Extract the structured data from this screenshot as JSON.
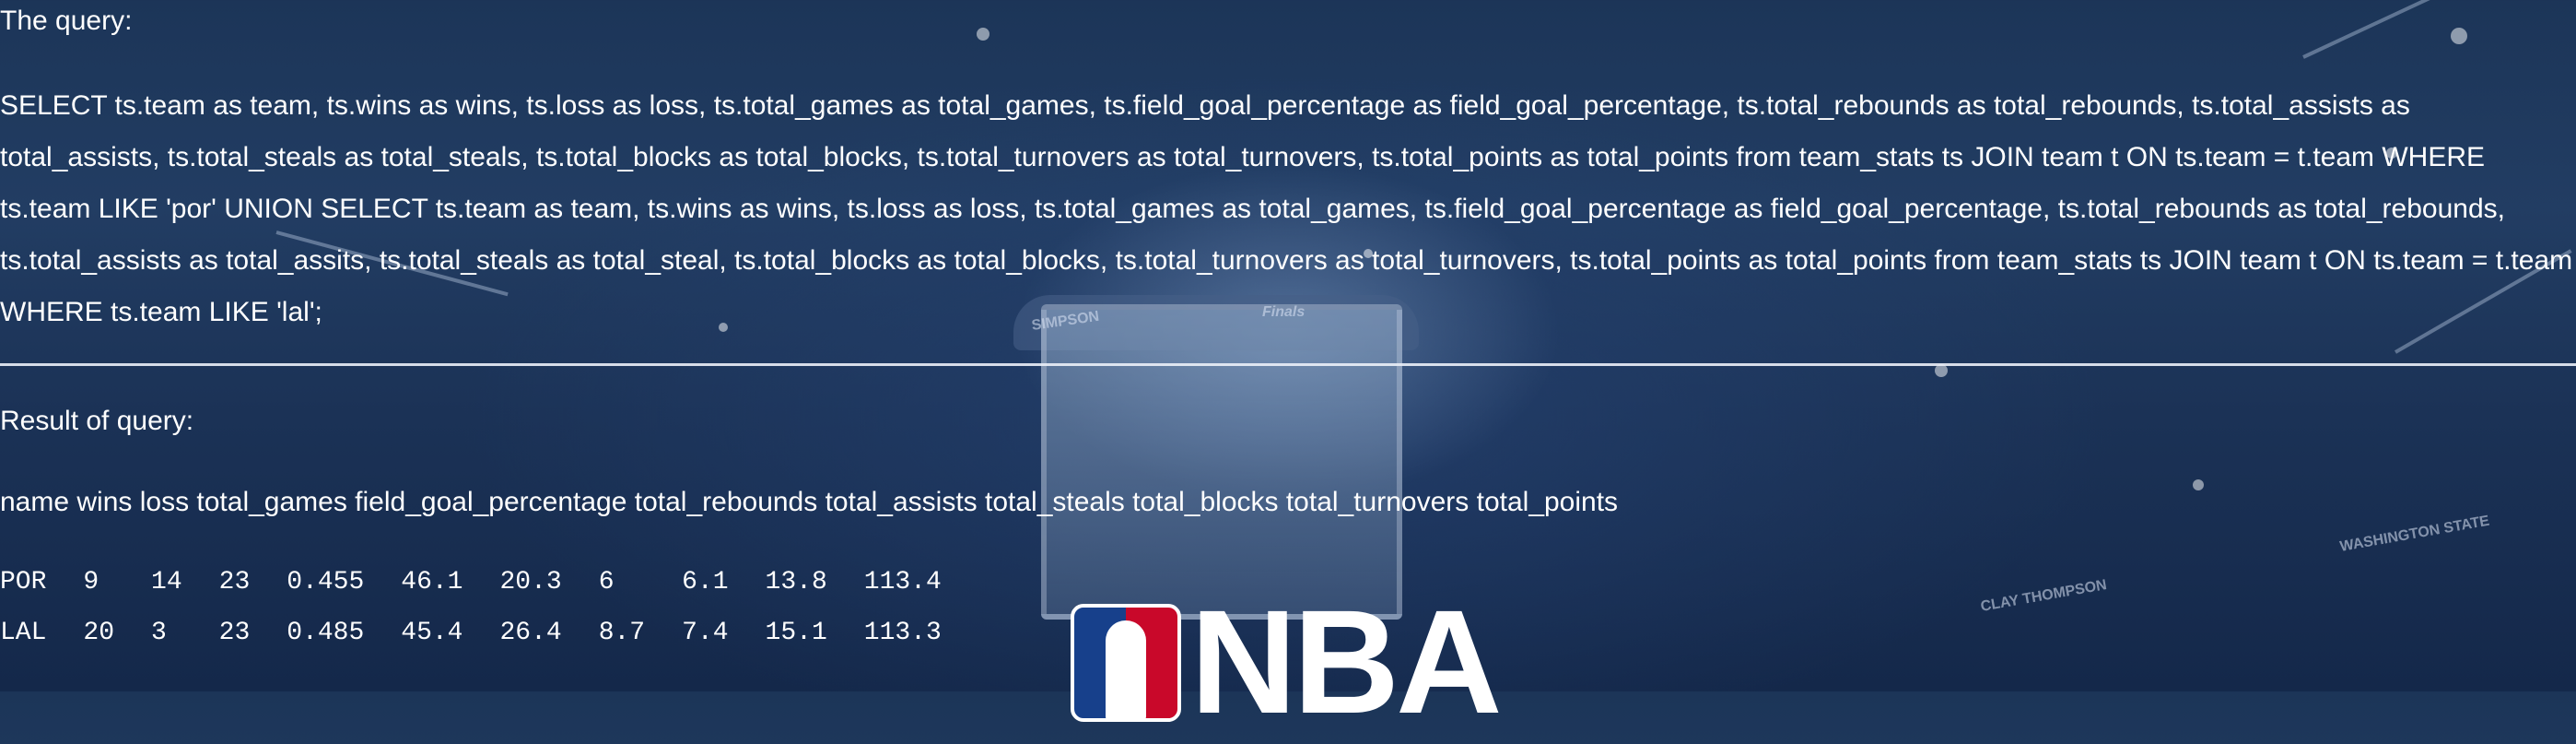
{
  "query_section": {
    "label": "The query:",
    "sql": "SELECT ts.team as team, ts.wins as wins, ts.loss as loss, ts.total_games as total_games, ts.field_goal_percentage as field_goal_percentage, ts.total_rebounds as total_rebounds, ts.total_assists as total_assists, ts.total_steals as total_steals, ts.total_blocks as total_blocks, ts.total_turnovers as total_turnovers, ts.total_points as total_points from team_stats ts JOIN team t ON ts.team = t.team WHERE ts.team LIKE 'por' UNION SELECT ts.team as team, ts.wins as wins, ts.loss as loss, ts.total_games as total_games, ts.field_goal_percentage as field_goal_percentage, ts.total_rebounds as total_rebounds, ts.total_assists as total_assits, ts.total_steals as total_steal, ts.total_blocks as total_blocks, ts.total_turnovers as total_turnovers, ts.total_points as total_points from team_stats ts JOIN team t ON ts.team = t.team WHERE ts.team LIKE 'lal';"
  },
  "result_section": {
    "label": "Result of query:",
    "columns_line": "name wins loss total_games field_goal_percentage total_rebounds total_assists total_steals total_blocks total_turnovers total_points",
    "rows": [
      [
        "POR",
        "9",
        "14",
        "23",
        "0.455",
        "46.1",
        "20.3",
        "6",
        "6.1",
        "13.8",
        "113.4"
      ],
      [
        "LAL",
        "20",
        "3",
        "23",
        "0.485",
        "45.4",
        "26.4",
        "8.7",
        "7.4",
        "15.1",
        "113.3"
      ]
    ]
  },
  "background": {
    "logo_text": "NBA",
    "banner_texts": [
      "SIMPSON",
      "Finals",
      "CLAY THOMPSON",
      "WASHINGTON STATE"
    ],
    "colors": {
      "text": "#ffffff",
      "divider": "#ebf0f8",
      "nba_blue": "#17408b",
      "nba_red": "#c9082a"
    }
  }
}
